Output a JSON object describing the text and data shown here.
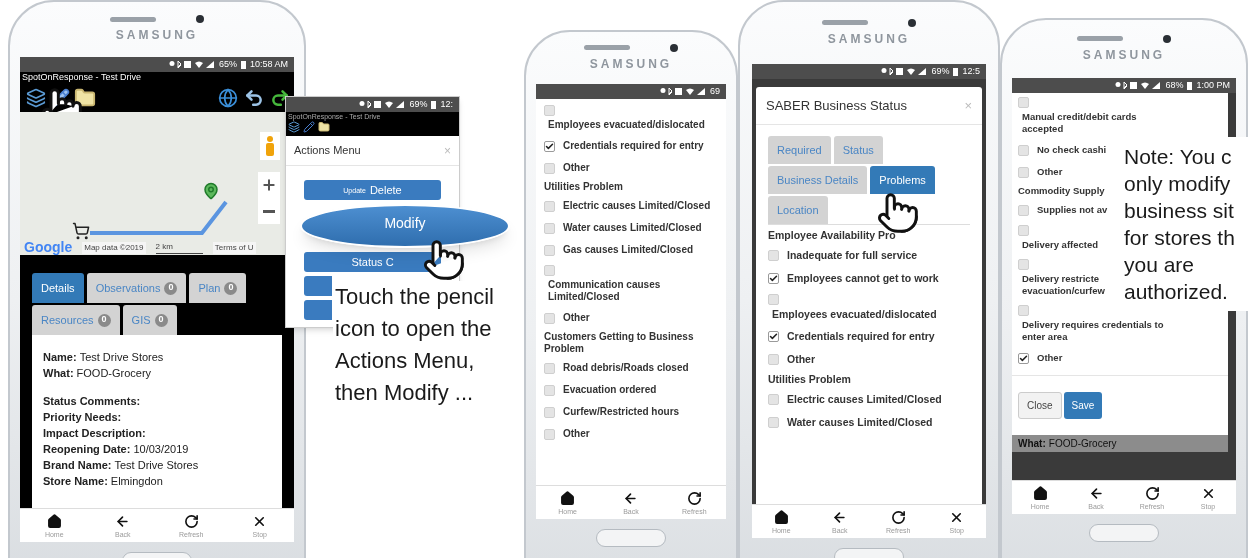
{
  "phone_1": {
    "brand": "SAMSUNG",
    "status_bar": {
      "battery": "65%",
      "time": "10:58 AM"
    },
    "app_title": "SpotOnResponse - Test Drive",
    "map": {
      "logo": "Google",
      "attribution": "Map data ©2019",
      "scale": "2 km",
      "terms": "Terms of U"
    },
    "tabs": [
      {
        "label": "Details",
        "selected": true
      },
      {
        "label": "Observations",
        "count": "0",
        "selected": false
      },
      {
        "label": "Plan",
        "count": "0",
        "selected": false
      },
      {
        "label": "Resources",
        "count": "0",
        "selected": false
      },
      {
        "label": "GIS",
        "count": "0",
        "selected": false
      }
    ],
    "detail_groups": [
      [
        {
          "label": "Name:",
          "value": "Test Drive Stores"
        },
        {
          "label": "What:",
          "value": "FOOD-Grocery"
        }
      ],
      [
        {
          "label": "Status Comments:"
        },
        {
          "label": "Priority Needs:"
        },
        {
          "label": "Impact Description:"
        },
        {
          "label": "Reopening Date:",
          "value": "10/03/2019"
        },
        {
          "label": "Brand Name:",
          "value": "Test Drive Stores"
        },
        {
          "label": "Store Name:",
          "value": "Elmingdon"
        }
      ]
    ],
    "nav": [
      {
        "kind": "home",
        "label": "Home"
      },
      {
        "kind": "back",
        "label": "Back"
      },
      {
        "kind": "refresh",
        "label": "Refresh"
      },
      {
        "kind": "stop",
        "label": "Stop"
      }
    ]
  },
  "actions_popup": {
    "status_bar": {
      "battery": "69%",
      "time": "12:"
    },
    "app_title": "SpotOnResponse - Test Drive",
    "dialog_title": "Actions Menu",
    "close": "×",
    "items": [
      {
        "kind": "button",
        "label": "Delete",
        "sublabel": "Update"
      },
      {
        "kind": "magnified",
        "label": "Modify"
      },
      {
        "kind": "button",
        "label": "Status C"
      },
      {
        "kind": "blank"
      },
      {
        "kind": "blank"
      }
    ],
    "caption": "Touch the pencil icon to open the Actions Menu, then Modify ..."
  },
  "phone_2": {
    "brand": "SAMSUNG",
    "status_bar": {
      "battery": "69"
    },
    "items": [
      {
        "kind": "check_below",
        "text": "Employees evacuated/dislocated",
        "checked": false
      },
      {
        "kind": "check",
        "text": "Credentials required for entry",
        "checked": true
      },
      {
        "kind": "check",
        "text": "Other",
        "checked": false
      },
      {
        "kind": "heading",
        "text": "Utilities Problem"
      },
      {
        "kind": "check",
        "text": "Electric causes Limited/Closed",
        "checked": false
      },
      {
        "kind": "check",
        "text": "Water causes Limited/Closed",
        "checked": false
      },
      {
        "kind": "check",
        "text": "Gas causes Limited/Closed",
        "checked": false
      },
      {
        "kind": "check_below",
        "text": "Communication causes Limited/Closed",
        "checked": false
      },
      {
        "kind": "check",
        "text": "Other",
        "checked": false
      },
      {
        "kind": "heading",
        "text": "Customers Getting to Business Problem"
      },
      {
        "kind": "check",
        "text": "Road debris/Roads closed",
        "checked": false
      },
      {
        "kind": "check",
        "text": "Evacuation ordered",
        "checked": false
      },
      {
        "kind": "check",
        "text": "Curfew/Restricted hours",
        "checked": false
      },
      {
        "kind": "check",
        "text": "Other",
        "checked": false
      }
    ],
    "nav": [
      {
        "kind": "home",
        "label": "Home"
      },
      {
        "kind": "back",
        "label": "Back"
      },
      {
        "kind": "refresh",
        "label": "Refresh"
      }
    ]
  },
  "phone_3": {
    "brand": "SAMSUNG",
    "status_bar": {
      "battery": "69%",
      "time": "12:5"
    },
    "dialog_title": "SABER Business Status",
    "close": "×",
    "tabs": [
      {
        "label": "Required",
        "selected": false
      },
      {
        "label": "Status",
        "selected": false
      },
      {
        "label": "Business Details",
        "selected": false
      },
      {
        "label": "Problems",
        "selected": true
      },
      {
        "label": "Location",
        "selected": false
      }
    ],
    "items": [
      {
        "kind": "heading",
        "text": "Employee Availability Pro"
      },
      {
        "kind": "check",
        "text": "Inadequate for full service",
        "checked": false
      },
      {
        "kind": "check",
        "text": "Employees cannot get to work",
        "checked": true
      },
      {
        "kind": "check_below",
        "text": "Employees evacuated/dislocated",
        "checked": false
      },
      {
        "kind": "check",
        "text": "Credentials required for entry",
        "checked": true
      },
      {
        "kind": "check",
        "text": "Other",
        "checked": false
      },
      {
        "kind": "heading",
        "text": "Utilities Problem"
      },
      {
        "kind": "check",
        "text": "Electric causes Limited/Closed",
        "checked": false
      },
      {
        "kind": "check",
        "text": "Water causes Limited/Closed",
        "checked": false
      }
    ],
    "nav": [
      {
        "kind": "home",
        "label": "Home"
      },
      {
        "kind": "back",
        "label": "Back"
      },
      {
        "kind": "refresh",
        "label": "Refresh"
      },
      {
        "kind": "stop",
        "label": "Stop"
      }
    ]
  },
  "phone_4": {
    "brand": "SAMSUNG",
    "status_bar": {
      "battery": "68%",
      "time": "1:00 PM"
    },
    "items": [
      {
        "kind": "check_below",
        "text": "Manual credit/debit cards\naccepted",
        "checked": false
      },
      {
        "kind": "check",
        "text": "No check cashi",
        "checked": false
      },
      {
        "kind": "check",
        "text": "Other",
        "checked": false
      },
      {
        "kind": "heading",
        "text": "Commodity Supply"
      },
      {
        "kind": "check",
        "text": "Supplies not av",
        "checked": false
      },
      {
        "kind": "check_below",
        "text": "Delivery affected",
        "checked": false
      },
      {
        "kind": "check_below",
        "text": "Delivery restricte\nevacuation/curfew",
        "checked": false
      },
      {
        "kind": "check_below",
        "text": "Delivery requires credentials to\nenter area",
        "checked": false
      },
      {
        "kind": "check",
        "text": "Other",
        "checked": true
      }
    ],
    "buttons": [
      {
        "kind": "default",
        "label": "Close"
      },
      {
        "kind": "primary",
        "label": "Save"
      }
    ],
    "behind": {
      "label": "What:",
      "value": "FOOD-Grocery"
    },
    "nav": [
      {
        "kind": "home",
        "label": "Home"
      },
      {
        "kind": "back",
        "label": "Back"
      },
      {
        "kind": "refresh",
        "label": "Refresh"
      },
      {
        "kind": "stop",
        "label": "Stop"
      }
    ]
  },
  "note": [
    "Note: You c",
    "only modify",
    "business sit",
    "for stores th",
    "you are",
    "authorized."
  ]
}
